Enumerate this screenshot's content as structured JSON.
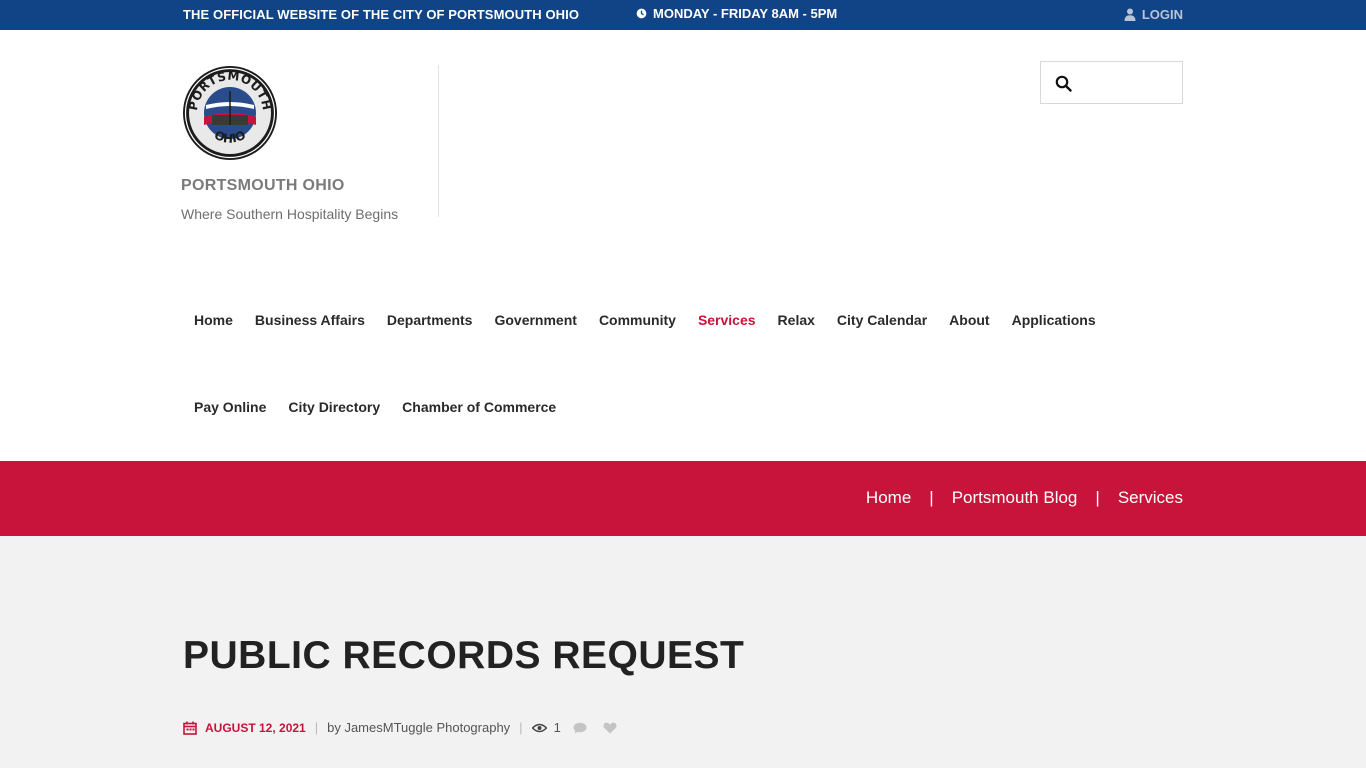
{
  "topbar": {
    "official_text": "THE OFFICIAL WEBSITE OF THE CITY OF PORTSMOUTH OHIO",
    "hours_text": "MONDAY - FRIDAY 8AM - 5PM",
    "login_label": "LOGIN",
    "background_color": "#114486"
  },
  "header": {
    "logo_top_text": "PORTSMOUTH",
    "logo_bottom_text": "OHIO",
    "site_name": "PORTSMOUTH OHIO",
    "tagline": "Where Southern Hospitality Begins"
  },
  "search": {
    "placeholder": "",
    "value": ""
  },
  "nav": {
    "row1": [
      {
        "label": "Home"
      },
      {
        "label": "Business Affairs"
      },
      {
        "label": "Departments"
      },
      {
        "label": "Government"
      },
      {
        "label": "Community"
      },
      {
        "label": "Services",
        "active": true
      },
      {
        "label": "Relax"
      },
      {
        "label": "City Calendar"
      },
      {
        "label": "About"
      },
      {
        "label": "Applications"
      }
    ],
    "row2": [
      {
        "label": "Pay Online"
      },
      {
        "label": "City Directory"
      },
      {
        "label": "Chamber of Commerce"
      }
    ],
    "active_color": "#c8133a"
  },
  "breadcrumb": {
    "items": [
      "Home",
      "Portsmouth Blog",
      "Services"
    ],
    "separator": "|",
    "background_color": "#c8133a"
  },
  "post": {
    "title": "PUBLIC RECORDS REQUEST",
    "date": "AUGUST 12, 2021",
    "author": "by JamesMTuggle Photography",
    "views": "1",
    "separator": "|"
  }
}
